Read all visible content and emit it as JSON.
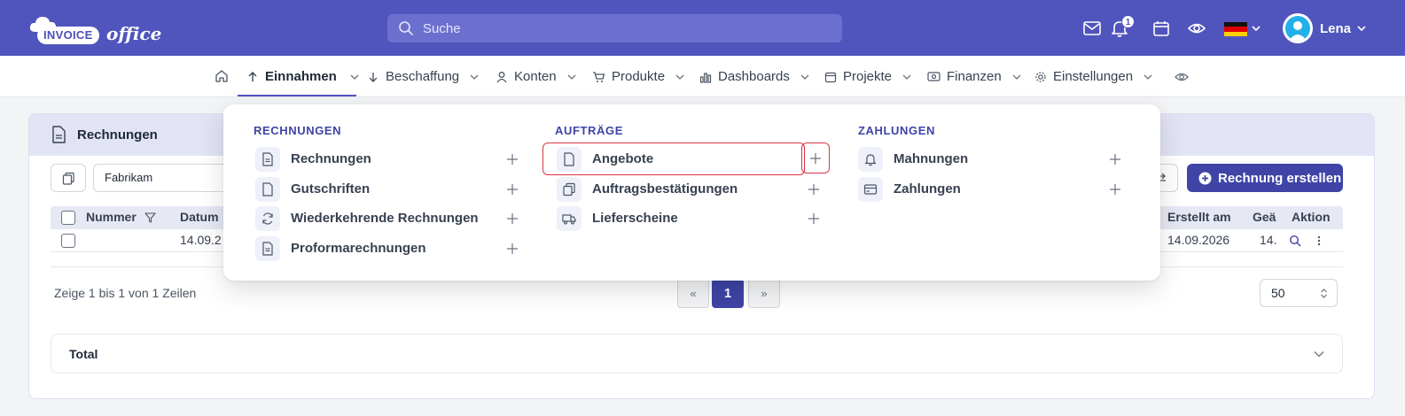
{
  "app": {
    "logo_pill": "INVOICE",
    "logo_script": "office",
    "search_placeholder": "Suche",
    "notification_count": "1",
    "user_name": "Lena",
    "language_flag": "de"
  },
  "nav": {
    "items": [
      {
        "label": "Einnahmen",
        "icon": "arrow-up-icon",
        "active": true
      },
      {
        "label": "Beschaffung",
        "icon": "arrow-down-icon"
      },
      {
        "label": "Konten",
        "icon": "user-icon"
      },
      {
        "label": "Produkte",
        "icon": "cart-icon"
      },
      {
        "label": "Dashboards",
        "icon": "bar-chart-icon"
      },
      {
        "label": "Projekte",
        "icon": "calendar-icon"
      },
      {
        "label": "Finanzen",
        "icon": "banknote-icon"
      },
      {
        "label": "Einstellungen",
        "icon": "gear-icon"
      }
    ]
  },
  "dropdown": {
    "columns": [
      {
        "title": "RECHNUNGEN",
        "items": [
          {
            "label": "Rechnungen",
            "icon": "invoice-icon"
          },
          {
            "label": "Gutschriften",
            "icon": "document-icon"
          },
          {
            "label": "Wiederkehrende Rechnungen",
            "icon": "refresh-icon"
          },
          {
            "label": "Proformarechnungen",
            "icon": "invoice-icon"
          }
        ]
      },
      {
        "title": "AUFTRÄGE",
        "items": [
          {
            "label": "Angebote",
            "icon": "document-icon"
          },
          {
            "label": "Auftragsbestätigungen",
            "icon": "clipboard-icon"
          },
          {
            "label": "Lieferscheine",
            "icon": "truck-icon"
          }
        ]
      },
      {
        "title": "ZAHLUNGEN",
        "items": [
          {
            "label": "Mahnungen",
            "icon": "bell-icon"
          },
          {
            "label": "Zahlungen",
            "icon": "credit-card-icon"
          }
        ]
      }
    ]
  },
  "card": {
    "title": "Rechnungen",
    "filter_value": "Fabrikam",
    "create_button": "Rechnung erstellen",
    "columns": {
      "number": "Nummer",
      "date": "Datum",
      "created": "Erstellt am",
      "changed": "Geä",
      "action": "Aktion"
    },
    "row": {
      "date": "14.09.2",
      "created": "14.09.2026",
      "changed": "14."
    },
    "pagination_info": "Zeige 1 bis 1 von 1 Zeilen",
    "pagination": {
      "prev": "«",
      "current": "1",
      "next": "»"
    },
    "page_size": "50",
    "total_label": "Total"
  },
  "colors": {
    "brand": "#5055bd",
    "primary_button": "#3f44a6",
    "highlight": "#dc3545"
  }
}
